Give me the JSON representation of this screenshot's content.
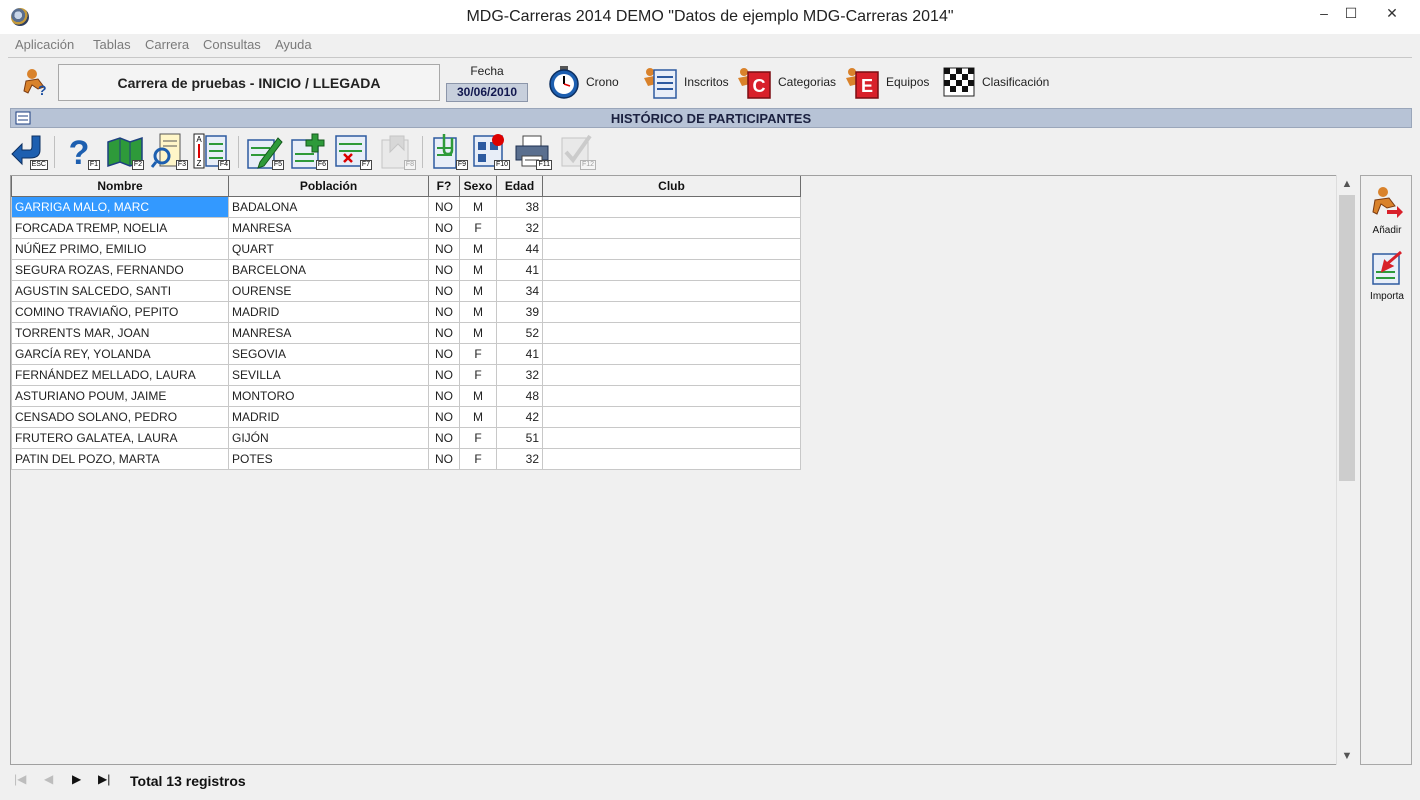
{
  "window": {
    "title": "MDG-Carreras 2014 DEMO \"Datos de ejemplo MDG-Carreras 2014\"",
    "minimize": "–",
    "maximize": "☐",
    "close": "✕"
  },
  "menu": [
    "Aplicación",
    "Tablas",
    "Carrera",
    "Consultas",
    "Ayuda"
  ],
  "header": {
    "race": "Carrera de pruebas - INICIO / LLEGADA",
    "fecha_label": "Fecha",
    "fecha_value": "30/06/2010",
    "nav": [
      {
        "label": "Crono",
        "icon": "stopwatch-icon"
      },
      {
        "label": "Inscritos",
        "icon": "runner-list-icon"
      },
      {
        "label": "Categorias",
        "icon": "categories-icon"
      },
      {
        "label": "Equipos",
        "icon": "teams-icon"
      },
      {
        "label": "Clasificación",
        "icon": "checkered-flag-icon"
      }
    ]
  },
  "section_title": "HISTÓRICO DE PARTICIPANTES",
  "toolbar": {
    "keys": [
      "ESC",
      "F1",
      "F2",
      "F3",
      "F4",
      "F5",
      "F6",
      "F7",
      "F8",
      "F9",
      "F10",
      "F11",
      "F12"
    ]
  },
  "grid": {
    "columns": [
      "Nombre",
      "Población",
      "F?",
      "Sexo",
      "Edad",
      "Club"
    ],
    "rows": [
      [
        "GARRIGA MALO, MARC",
        "BADALONA",
        "NO",
        "M",
        "38",
        ""
      ],
      [
        "FORCADA TREMP, NOELIA",
        "MANRESA",
        "NO",
        "F",
        "32",
        ""
      ],
      [
        "NÚÑEZ PRIMO, EMILIO",
        "QUART",
        "NO",
        "M",
        "44",
        ""
      ],
      [
        "SEGURA ROZAS, FERNANDO",
        "BARCELONA",
        "NO",
        "M",
        "41",
        ""
      ],
      [
        "AGUSTIN SALCEDO, SANTI",
        "OURENSE",
        "NO",
        "M",
        "34",
        ""
      ],
      [
        "COMINO TRAVIAÑO, PEPITO",
        "MADRID",
        "NO",
        "M",
        "39",
        ""
      ],
      [
        "TORRENTS MAR, JOAN",
        "MANRESA",
        "NO",
        "M",
        "52",
        ""
      ],
      [
        "GARCÍA REY, YOLANDA",
        "SEGOVIA",
        "NO",
        "F",
        "41",
        ""
      ],
      [
        "FERNÁNDEZ MELLADO, LAURA",
        "SEVILLA",
        "NO",
        "F",
        "32",
        ""
      ],
      [
        "ASTURIANO POUM, JAIME",
        "MONTORO",
        "NO",
        "M",
        "48",
        ""
      ],
      [
        "CENSADO SOLANO, PEDRO",
        "MADRID",
        "NO",
        "M",
        "42",
        ""
      ],
      [
        "FRUTERO GALATEA, LAURA",
        "GIJÓN",
        "NO",
        "F",
        "51",
        ""
      ],
      [
        "PATIN DEL POZO, MARTA",
        "POTES",
        "NO",
        "F",
        "32",
        ""
      ]
    ]
  },
  "side": {
    "add_label": "Añadir",
    "import_label": "Importa"
  },
  "footer": {
    "first": "|◀",
    "prev": "◀",
    "next": "▶",
    "last": "▶|",
    "total": "Total 13 registros"
  }
}
